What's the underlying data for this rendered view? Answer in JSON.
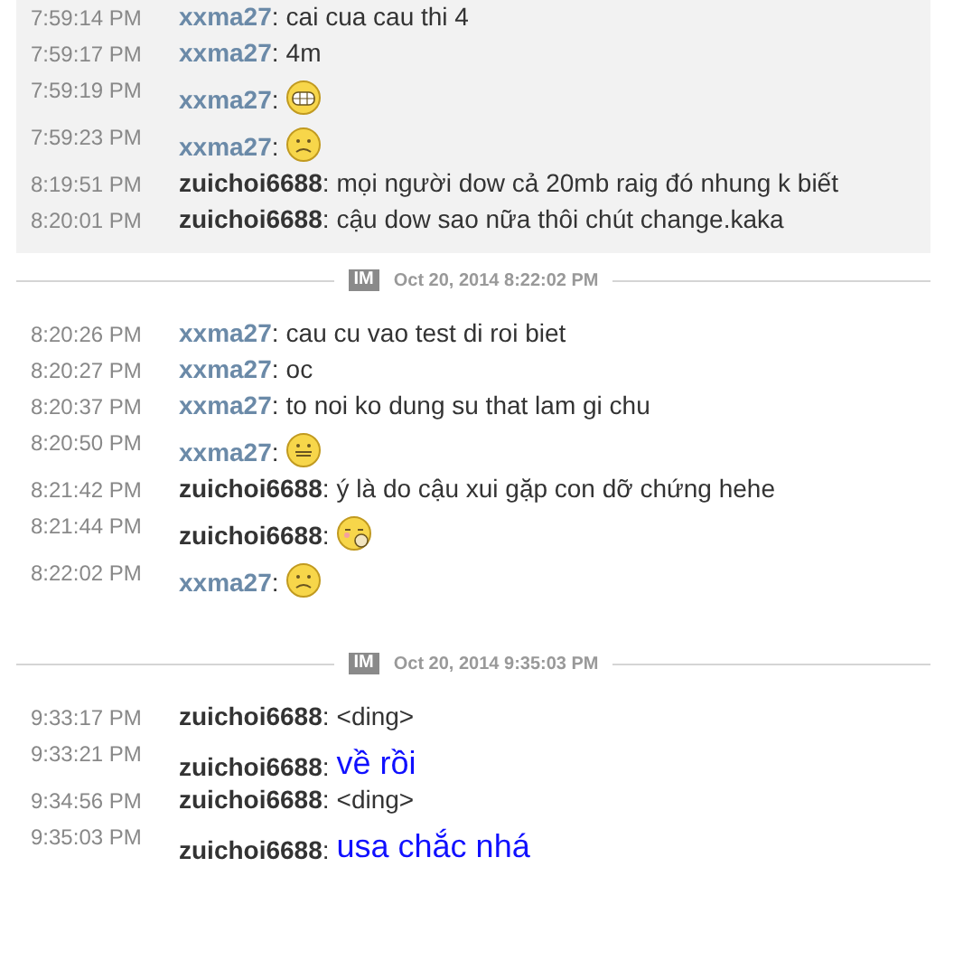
{
  "sessions": [
    {
      "highlighted": true,
      "messages": [
        {
          "time": "7:59:14 PM",
          "sender": "**xxma27**:",
          "self": false,
          "kind": "text",
          "text": "cai cua cau thi 4"
        },
        {
          "time": "7:59:17 PM",
          "sender": "**xxma27**:",
          "self": false,
          "kind": "text",
          "text": "4m"
        },
        {
          "time": "7:59:19 PM",
          "sender": "**xxma27**:",
          "self": false,
          "kind": "grin"
        },
        {
          "time": "7:59:23 PM",
          "sender": "**xxma27**:",
          "self": false,
          "kind": "worried"
        },
        {
          "time": "8:19:51 PM",
          "sender": "**zuichoi6688**:",
          "self": true,
          "kind": "text",
          "text": "mọi người dow cả 20mb raig đó nhung k biết"
        },
        {
          "time": "8:20:01 PM",
          "sender": "**zuichoi6688**:",
          "self": true,
          "kind": "text",
          "text": "cậu dow sao nữa thôi chút change.kaka"
        }
      ]
    },
    {
      "highlighted": false,
      "divider": {
        "badge": "IM",
        "timestamp": "Oct 20, 2014 8:22:02 PM"
      },
      "messages": [
        {
          "time": "8:20:26 PM",
          "sender": "**xxma27**:",
          "self": false,
          "kind": "text",
          "text": "cau cu vao test di roi biet"
        },
        {
          "time": "8:20:27 PM",
          "sender": "**xxma27**:",
          "self": false,
          "kind": "text",
          "text": "oc"
        },
        {
          "time": "8:20:37 PM",
          "sender": "**xxma27**:",
          "self": false,
          "kind": "text",
          "text": "to noi ko dung su that lam gi chu"
        },
        {
          "time": "8:20:50 PM",
          "sender": "**xxma27**:",
          "self": false,
          "kind": "neutral"
        },
        {
          "time": "8:21:42 PM",
          "sender": "**zuichoi6688**:",
          "self": true,
          "kind": "text",
          "text": "ý là do cậu xui gặp con dỡ chứng hehe"
        },
        {
          "time": "8:21:44 PM",
          "sender": "**zuichoi6688**:",
          "self": true,
          "kind": "wink"
        },
        {
          "time": "8:22:02 PM",
          "sender": "**xxma27**:",
          "self": false,
          "kind": "worried"
        }
      ]
    },
    {
      "highlighted": false,
      "divider": {
        "badge": "IM",
        "timestamp": "Oct 20, 2014 9:35:03 PM"
      },
      "messages": [
        {
          "time": "9:33:17 PM",
          "sender": "**zuichoi6688**:",
          "self": true,
          "kind": "text",
          "text": "<ding>"
        },
        {
          "time": "9:33:21 PM",
          "sender": "**zuichoi6688**:",
          "self": true,
          "kind": "large",
          "text": "về rồi"
        },
        {
          "time": "9:34:56 PM",
          "sender": "**zuichoi6688**:",
          "self": true,
          "kind": "text",
          "text": "<ding>"
        },
        {
          "time": "9:35:03 PM",
          "sender": "**zuichoi6688**:",
          "self": true,
          "kind": "large",
          "text": "usa chắc nhá"
        }
      ]
    }
  ]
}
